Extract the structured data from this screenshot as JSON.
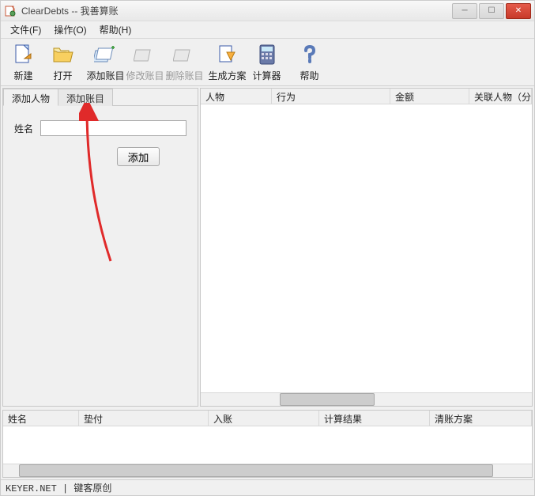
{
  "title": "ClearDebts -- 我善算账",
  "menu": {
    "file": "文件(F)",
    "action": "操作(O)",
    "help": "帮助(H)"
  },
  "toolbar": {
    "new": "新建",
    "open": "打开",
    "add_entry": "添加账目",
    "edit_entry": "修改账目",
    "delete_entry": "删除账目",
    "gen_plan": "生成方案",
    "calculator": "计算器",
    "help": "帮助"
  },
  "tabs": {
    "add_person": "添加人物",
    "add_entry": "添加账目"
  },
  "form": {
    "name_label": "姓名",
    "name_value": "",
    "add_btn": "添加"
  },
  "right_cols": {
    "person": "人物",
    "action": "行为",
    "amount": "金额",
    "related": "关联人物（分"
  },
  "bottom_cols": {
    "name": "姓名",
    "paid": "垫付",
    "received": "入账",
    "result": "计算结果",
    "plan": "清账方案"
  },
  "status": "KEYER.NET | 键客原创"
}
